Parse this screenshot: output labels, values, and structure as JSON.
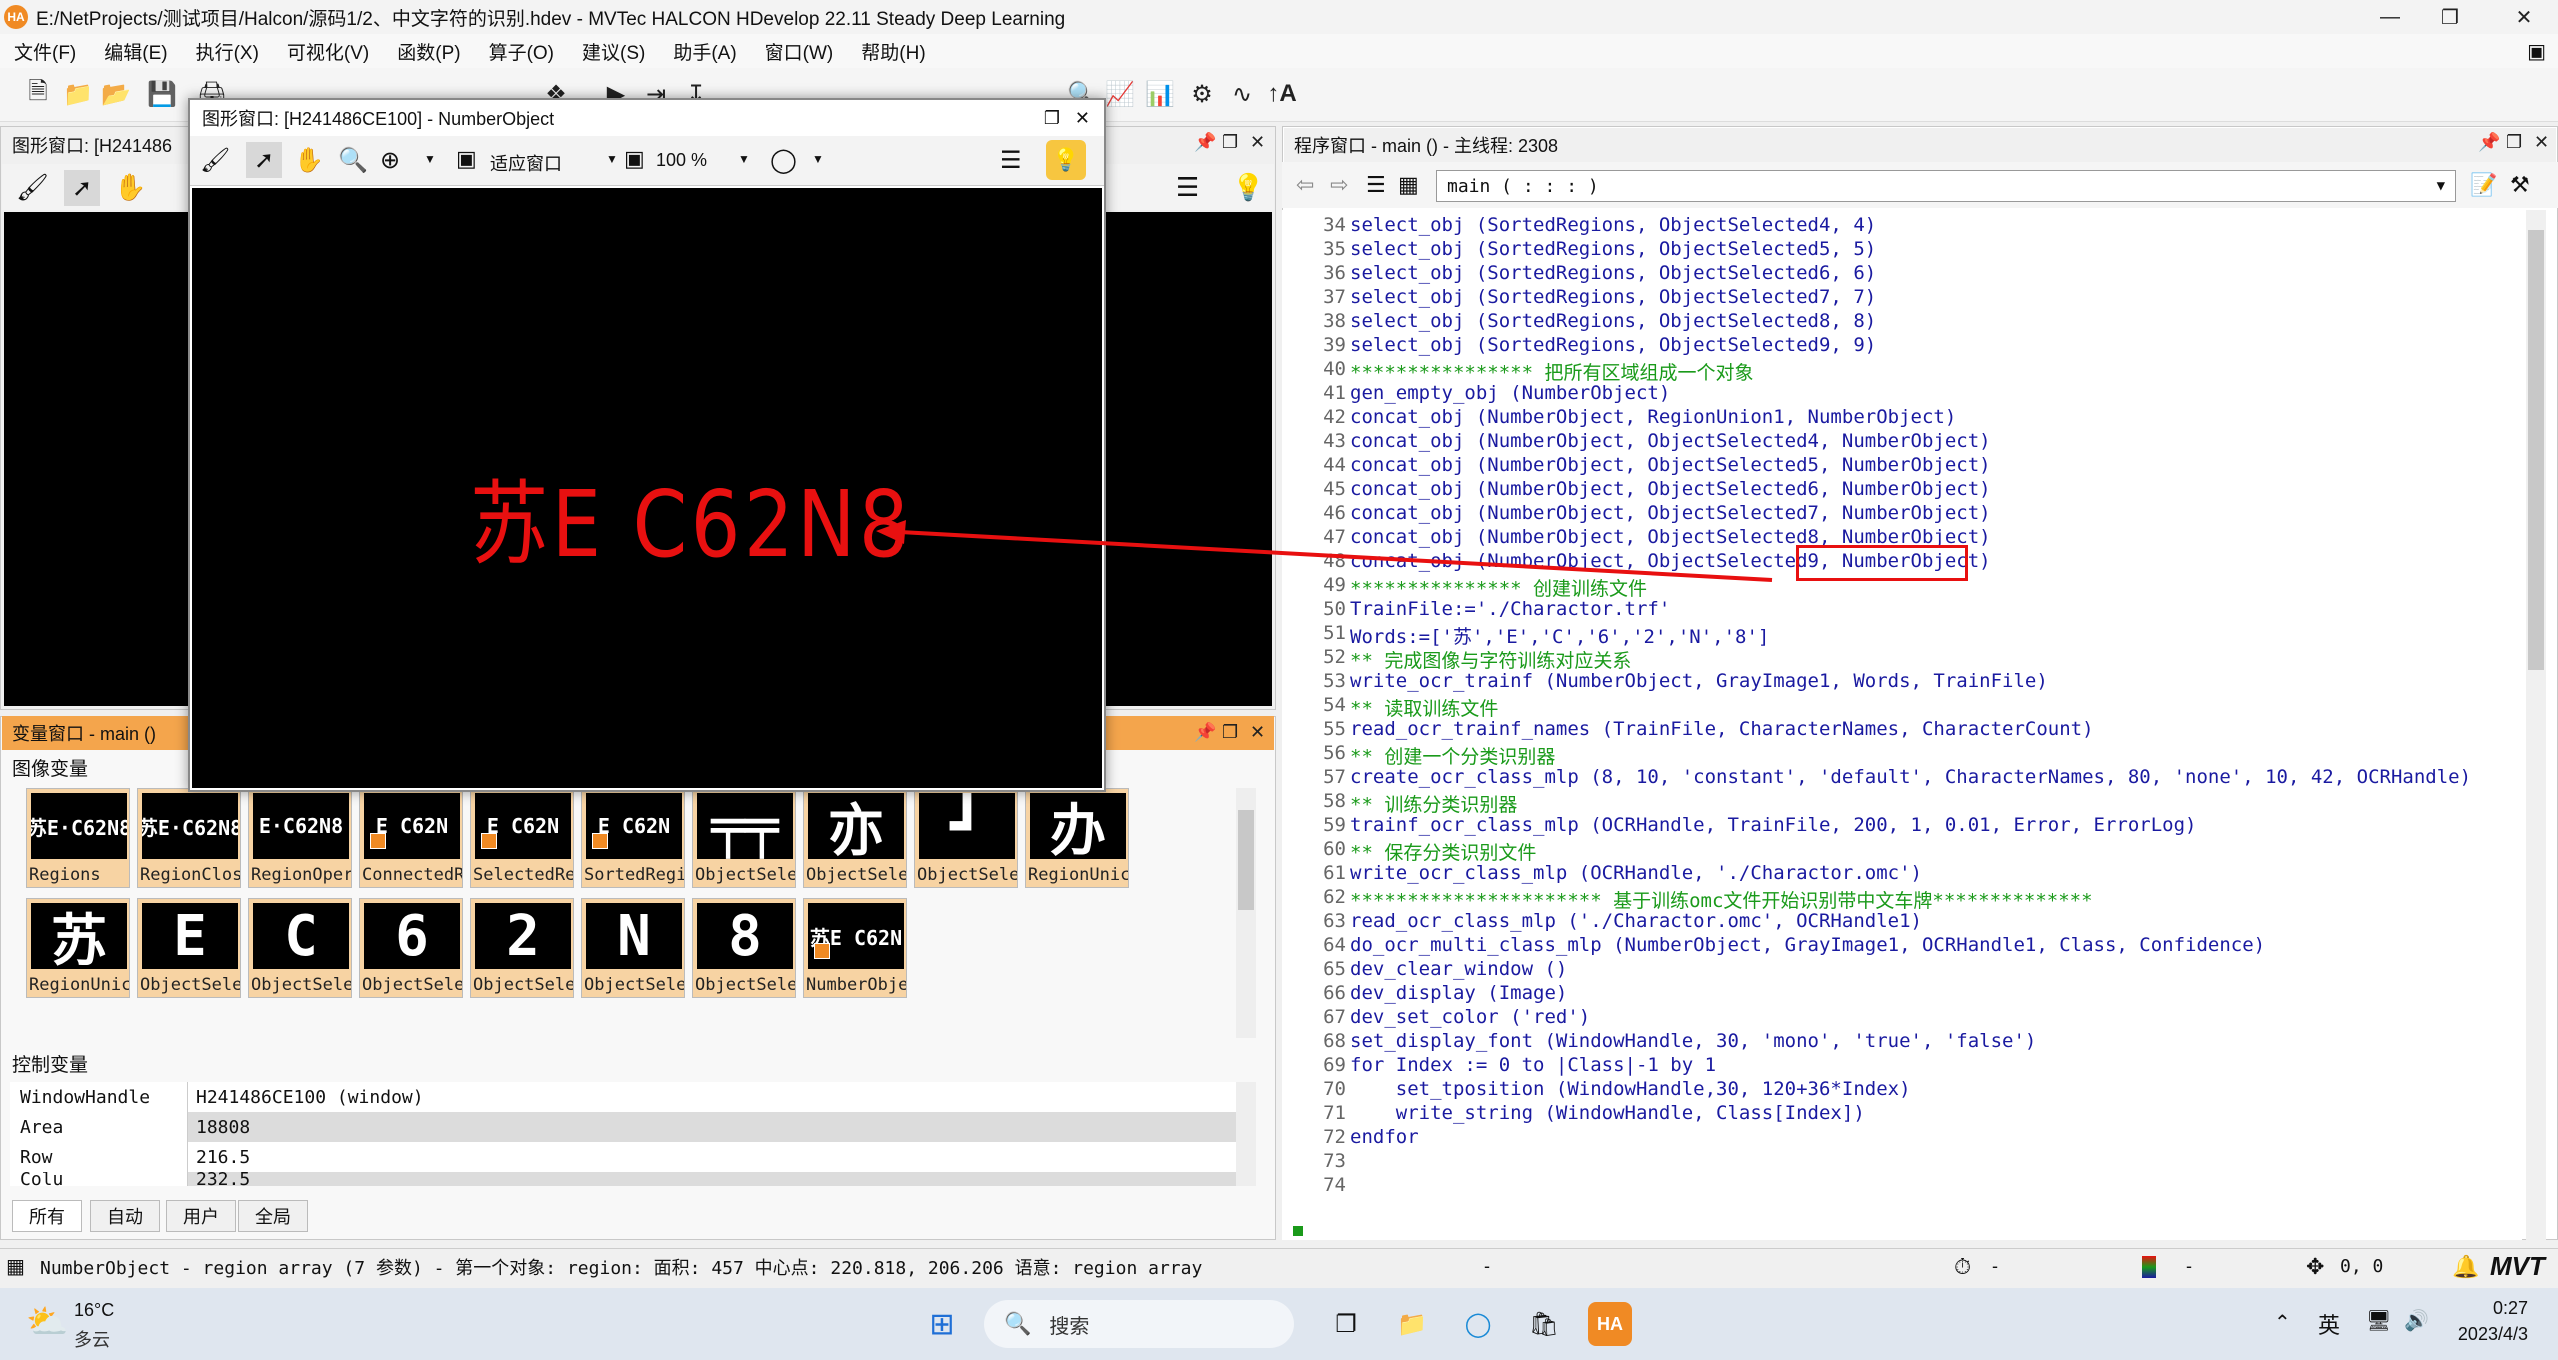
{
  "window": {
    "title": "E:/NetProjects/测试项目/Halcon/源码1/2、中文字符的识别.hdev - MVTec HALCON HDevelop 22.11 Steady Deep Learning",
    "app_icon": "HA"
  },
  "menu": [
    "文件(F)",
    "编辑(E)",
    "执行(X)",
    "可视化(V)",
    "函数(P)",
    "算子(O)",
    "建议(S)",
    "助手(A)",
    "窗口(W)",
    "帮助(H)"
  ],
  "graphics_panel": {
    "title": "图形窗口: [H241486"
  },
  "float_window": {
    "title": "图形窗口: [H241486CE100] - NumberObject",
    "fit_label": "适应窗口",
    "zoom": "100 %",
    "plate": "苏E C62N8"
  },
  "variables_panel": {
    "title": "变量窗口 - main ()",
    "image_vars_label": "图像变量",
    "thumbs_row1": [
      {
        "name": "Regions",
        "glyph": "苏E·C62N8"
      },
      {
        "name": "RegionClos",
        "glyph": "苏E·C62N8"
      },
      {
        "name": "RegionOper",
        "glyph": "E·C62N8"
      },
      {
        "name": "ConnectedR",
        "glyph": "E C62N"
      },
      {
        "name": "SelectedRe",
        "glyph": "E C62N"
      },
      {
        "name": "SortedRegi",
        "glyph": "E C62N"
      },
      {
        "name": "ObjectSele",
        "glyph": "╤╤"
      },
      {
        "name": "ObjectSele",
        "glyph": "亦"
      },
      {
        "name": "ObjectSele",
        "glyph": "┛"
      },
      {
        "name": "RegionUnic",
        "glyph": "办"
      }
    ],
    "thumbs_row2": [
      {
        "name": "RegionUnic",
        "glyph": "苏"
      },
      {
        "name": "ObjectSele",
        "glyph": "E"
      },
      {
        "name": "ObjectSele",
        "glyph": "C"
      },
      {
        "name": "ObjectSele",
        "glyph": "6"
      },
      {
        "name": "ObjectSele",
        "glyph": "2"
      },
      {
        "name": "ObjectSele",
        "glyph": "N"
      },
      {
        "name": "ObjectSele",
        "glyph": "8"
      },
      {
        "name": "NumberObje",
        "glyph": "苏E C62N"
      }
    ],
    "control_vars_label": "控制变量",
    "control_vars": [
      {
        "name": "WindowHandle",
        "value": "H241486CE100 (window)"
      },
      {
        "name": "Area",
        "value": "18808"
      },
      {
        "name": "Row",
        "value": "216.5"
      },
      {
        "name": "Colu",
        "value": "232.5"
      }
    ],
    "tabs": [
      "所有",
      "自动",
      "用户",
      "全局"
    ]
  },
  "program_panel": {
    "title": "程序窗口 - main () - 主线程: 2308",
    "procedure": "main ( : : : )",
    "lines": [
      {
        "n": "34",
        "t": "select_obj (SortedRegions, ObjectSelected4, 4)",
        "c": "op"
      },
      {
        "n": "35",
        "t": "select_obj (SortedRegions, ObjectSelected5, 5)",
        "c": "op"
      },
      {
        "n": "36",
        "t": "select_obj (SortedRegions, ObjectSelected6, 6)",
        "c": "op"
      },
      {
        "n": "37",
        "t": "select_obj (SortedRegions, ObjectSelected7, 7)",
        "c": "op"
      },
      {
        "n": "38",
        "t": "select_obj (SortedRegions, ObjectSelected8, 8)",
        "c": "op"
      },
      {
        "n": "39",
        "t": "select_obj (SortedRegions, ObjectSelected9, 9)",
        "c": "op"
      },
      {
        "n": "40",
        "t": "**************** 把所有区域组成一个对象",
        "c": "cmt"
      },
      {
        "n": "41",
        "t": "gen_empty_obj (NumberObject)",
        "c": "op"
      },
      {
        "n": "42",
        "t": "concat_obj (NumberObject, RegionUnion1, NumberObject)",
        "c": "op"
      },
      {
        "n": "43",
        "t": "concat_obj (NumberObject, ObjectSelected4, NumberObject)",
        "c": "op"
      },
      {
        "n": "44",
        "t": "concat_obj (NumberObject, ObjectSelected5, NumberObject)",
        "c": "op"
      },
      {
        "n": "45",
        "t": "concat_obj (NumberObject, ObjectSelected6, NumberObject)",
        "c": "op"
      },
      {
        "n": "46",
        "t": "concat_obj (NumberObject, ObjectSelected7, NumberObject)",
        "c": "op"
      },
      {
        "n": "47",
        "t": "concat_obj (NumberObject, ObjectSelected8, NumberObject)",
        "c": "op"
      },
      {
        "n": "48",
        "t": "concat_obj (NumberObject, ObjectSelected9, NumberObject)",
        "c": "op"
      },
      {
        "n": "49",
        "t": "*************** 创建训练文件",
        "c": "cmt"
      },
      {
        "n": "50",
        "t": "TrainFile:='./Charactor.trf'",
        "c": "op"
      },
      {
        "n": "51",
        "t": "Words:=['苏','E','C','6','2','N','8']",
        "c": "op"
      },
      {
        "n": "52",
        "t": "** 完成图像与字符训练对应关系",
        "c": "cmt"
      },
      {
        "n": "53",
        "t": "write_ocr_trainf (NumberObject, GrayImage1, Words, TrainFile)",
        "c": "op"
      },
      {
        "n": "54",
        "t": "** 读取训练文件",
        "c": "cmt"
      },
      {
        "n": "55",
        "t": "read_ocr_trainf_names (TrainFile, CharacterNames, CharacterCount)",
        "c": "op"
      },
      {
        "n": "56",
        "t": "** 创建一个分类识别器",
        "c": "cmt"
      },
      {
        "n": "57",
        "t": "create_ocr_class_mlp (8, 10, 'constant', 'default', CharacterNames, 80, 'none', 10, 42, OCRHandle)",
        "c": "op"
      },
      {
        "n": "58",
        "t": "** 训练分类识别器",
        "c": "cmt"
      },
      {
        "n": "59",
        "t": "trainf_ocr_class_mlp (OCRHandle, TrainFile, 200, 1, 0.01, Error, ErrorLog)",
        "c": "op"
      },
      {
        "n": "60",
        "t": "** 保存分类识别文件",
        "c": "cmt"
      },
      {
        "n": "61",
        "t": "write_ocr_class_mlp (OCRHandle, './Charactor.omc')",
        "c": "op"
      },
      {
        "n": "62",
        "t": "********************** 基于训练omc文件开始识别带中文车牌**************",
        "c": "cmt"
      },
      {
        "n": "63",
        "t": "read_ocr_class_mlp ('./Charactor.omc', OCRHandle1)",
        "c": "op"
      },
      {
        "n": "64",
        "t": "do_ocr_multi_class_mlp (NumberObject, GrayImage1, OCRHandle1, Class, Confidence)",
        "c": "op"
      },
      {
        "n": "65",
        "t": "dev_clear_window ()",
        "c": "op"
      },
      {
        "n": "66",
        "t": "dev_display (Image)",
        "c": "op"
      },
      {
        "n": "67",
        "t": "dev_set_color ('red')",
        "c": "op"
      },
      {
        "n": "68",
        "t": "set_display_font (WindowHandle, 30, 'mono', 'true', 'false')",
        "c": "op"
      },
      {
        "n": "69",
        "t": "for Index := 0 to |Class|-1 by 1",
        "c": "op"
      },
      {
        "n": "70",
        "t": "    set_tposition (WindowHandle,30, 120+36*Index)",
        "c": "op"
      },
      {
        "n": "71",
        "t": "    write_string (WindowHandle, Class[Index])",
        "c": "op"
      },
      {
        "n": "72",
        "t": "endfor",
        "c": "op"
      },
      {
        "n": "73",
        "t": "",
        "c": "op"
      },
      {
        "n": "74",
        "t": "",
        "c": "op"
      }
    ]
  },
  "status_bar": {
    "text": "NumberObject - region array (7 参数) - 第一个对象: region: 面积: 457 中心点: 220.818, 206.206 语意: region array",
    "dash1": "-",
    "dash2": "-",
    "dash3": "-",
    "coords": "0, 0",
    "logo": "MVT"
  },
  "taskbar": {
    "temperature": "16°C",
    "weather": "多云",
    "search": "搜索",
    "ime": "英",
    "time": "0:27",
    "date": "2023/4/3"
  },
  "colors": {
    "highlight_red": "#e81010",
    "variable_header": "#f4a54c",
    "thumb_bg": "#f7d3a3",
    "comment_green": "#1a9a1a",
    "code_blue": "#1a1aa0"
  }
}
